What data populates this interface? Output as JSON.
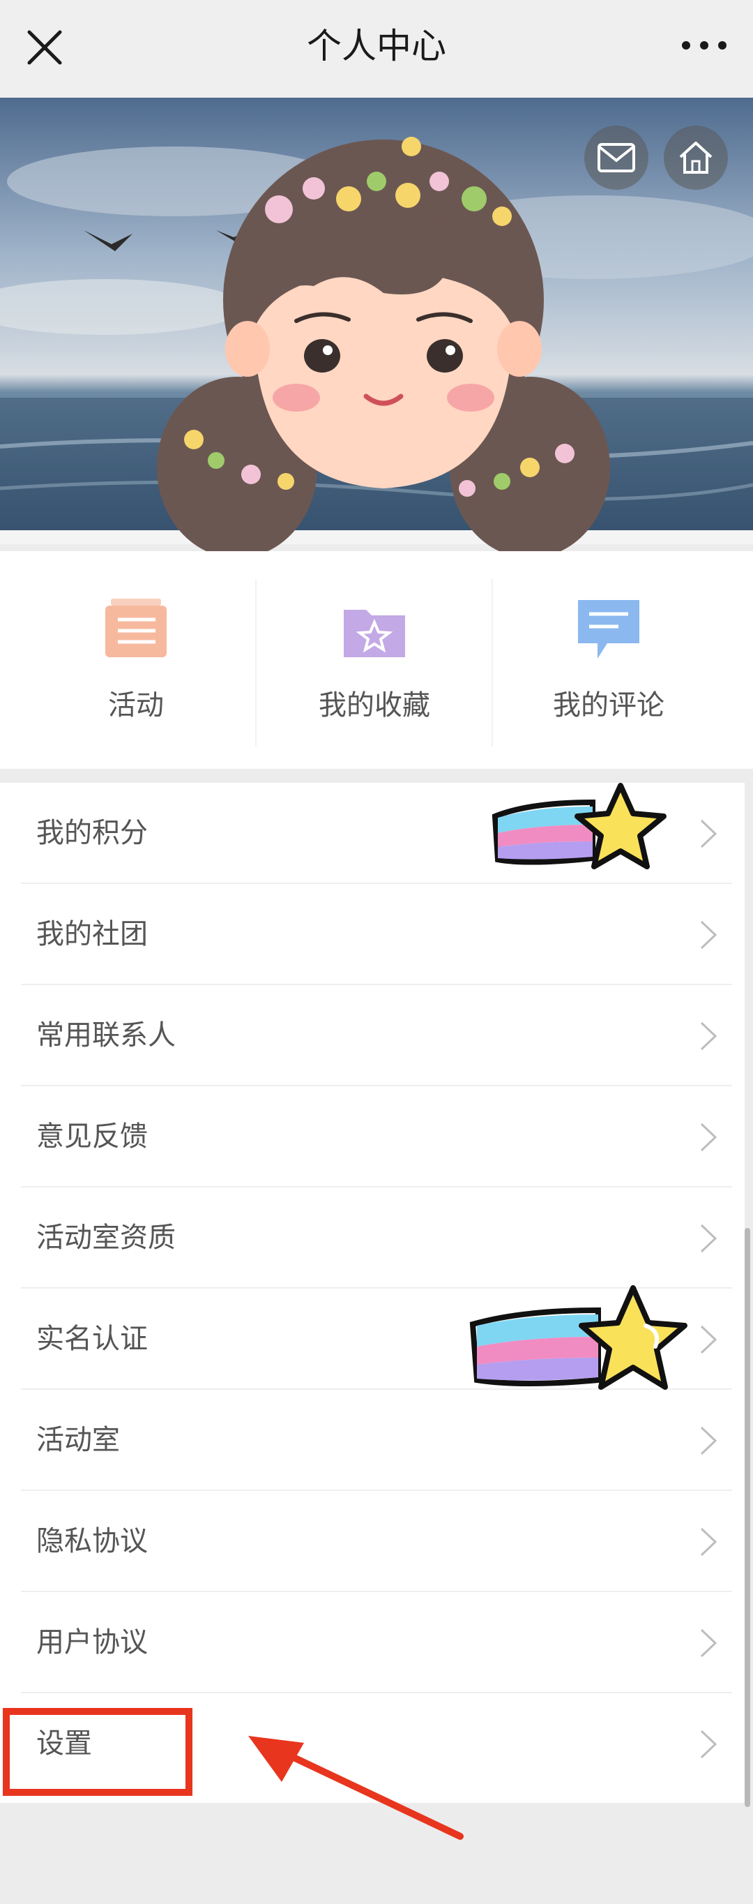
{
  "header": {
    "title": "个人中心"
  },
  "quick_actions": [
    {
      "label": "活动"
    },
    {
      "label": "我的收藏"
    },
    {
      "label": "我的评论"
    }
  ],
  "menu": [
    {
      "label": "我的积分"
    },
    {
      "label": "我的社团"
    },
    {
      "label": "常用联系人"
    },
    {
      "label": "意见反馈"
    },
    {
      "label": "活动室资质"
    },
    {
      "label": "实名认证"
    },
    {
      "label": "活动室"
    },
    {
      "label": "隐私协议"
    },
    {
      "label": "用户协议"
    },
    {
      "label": "设置"
    }
  ],
  "icons": {
    "close": "close-icon",
    "more": "more-dots-icon",
    "mail": "mail-icon",
    "home": "home-icon",
    "chevron": "chevron-right-icon"
  },
  "colors": {
    "highlight": "#e8351e",
    "activity_icon": "#f4a27e",
    "favorites_icon": "#b89ae0",
    "comments_icon": "#8bb8ef"
  }
}
